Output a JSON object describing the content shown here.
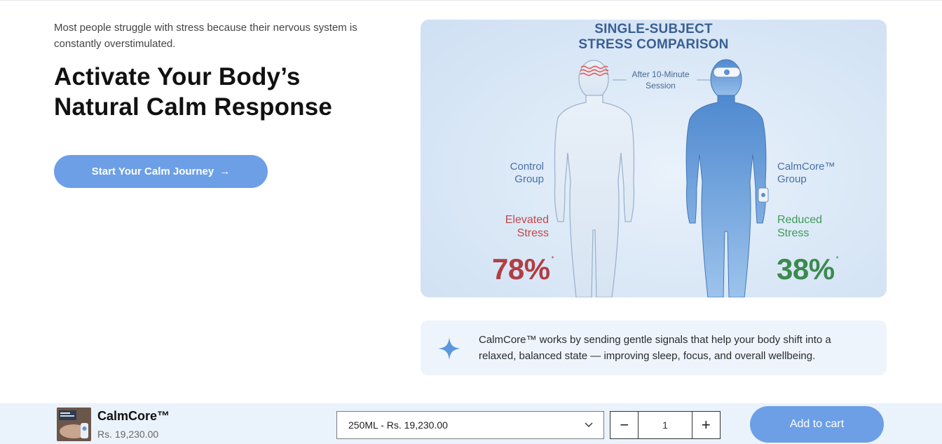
{
  "hero": {
    "intro": "Most people struggle with stress because their nervous system is constantly overstimulated.",
    "headline_line1": "Activate Your Body’s",
    "headline_line2": "Natural Calm Response",
    "cta_label": "Start Your Calm Journey",
    "cta_arrow": "→"
  },
  "figure": {
    "title_line1": "SINGLE-SUBJECT",
    "title_line2": "STRESS COMPARISON",
    "session_line1": "After 10-Minute",
    "session_line2": "Session",
    "left": {
      "group_line1": "Control",
      "group_line2": "Group",
      "stress_line1": "Elevated",
      "stress_line2": "Stress",
      "percent": "78%",
      "mark": "*"
    },
    "right": {
      "group_line1": "CalmCore™",
      "group_line2": "Group",
      "stress_line1": "Reduced",
      "stress_line2": "Stress",
      "percent": "38%",
      "mark": "*"
    },
    "colors": {
      "control_value": "#b13e43",
      "calm_value": "#3a8a4f",
      "body_blue": "#5f97d6"
    }
  },
  "note": {
    "icon": "sparkle-icon",
    "text": "CalmCore™ works by sending gentle signals that help your body shift into a relaxed, balanced state — improving sleep, focus, and overall wellbeing."
  },
  "sticky_bar": {
    "product_name": "CalmCore™",
    "product_price": "Rs. 19,230.00",
    "variant_selected": "250ML - Rs. 19,230.00",
    "quantity": "1",
    "minus": "−",
    "plus": "+",
    "add_to_cart": "Add to cart"
  }
}
